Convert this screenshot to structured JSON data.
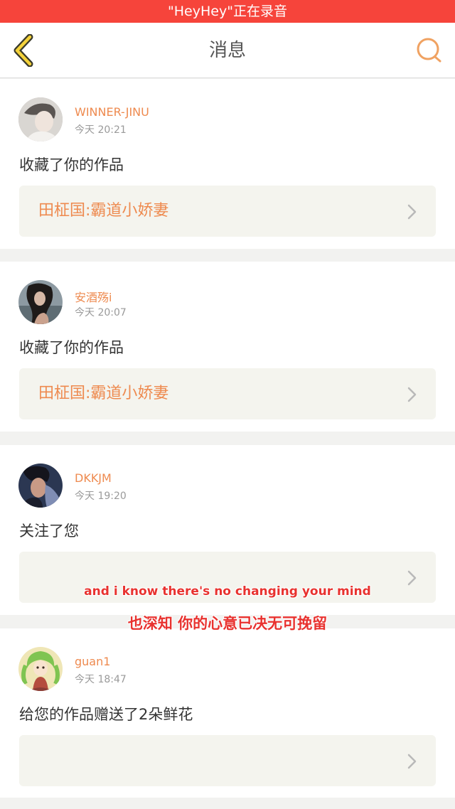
{
  "recording_banner": "\"HeyHey\"正在录音",
  "header": {
    "title": "消息",
    "back_icon": "chevron-left-icon",
    "search_icon": "search-icon"
  },
  "colors": {
    "recording_bar": "#f6443b",
    "accent": "#ee8a4f",
    "card_box": "#f4f4ee"
  },
  "messages": [
    {
      "username": "WINNER-JINU",
      "day": "今天",
      "time": "20:21",
      "action": "收藏了你的作品",
      "work_title": "田柾国:霸道小娇妻"
    },
    {
      "username": "安酒殇i",
      "day": "今天",
      "time": "20:07",
      "action": "收藏了你的作品",
      "work_title": "田柾国:霸道小娇妻"
    },
    {
      "username": "DKKJM",
      "day": "今天",
      "time": "19:20",
      "action": "关注了您",
      "work_title": ""
    },
    {
      "username": "guan1",
      "day": "今天",
      "time": "18:47",
      "action": "给您的作品赠送了2朵鲜花",
      "work_title": ""
    }
  ],
  "subtitles": {
    "english": "and i know there's no changing your mind",
    "chinese": "也深知 你的心意已决无可挽留"
  }
}
